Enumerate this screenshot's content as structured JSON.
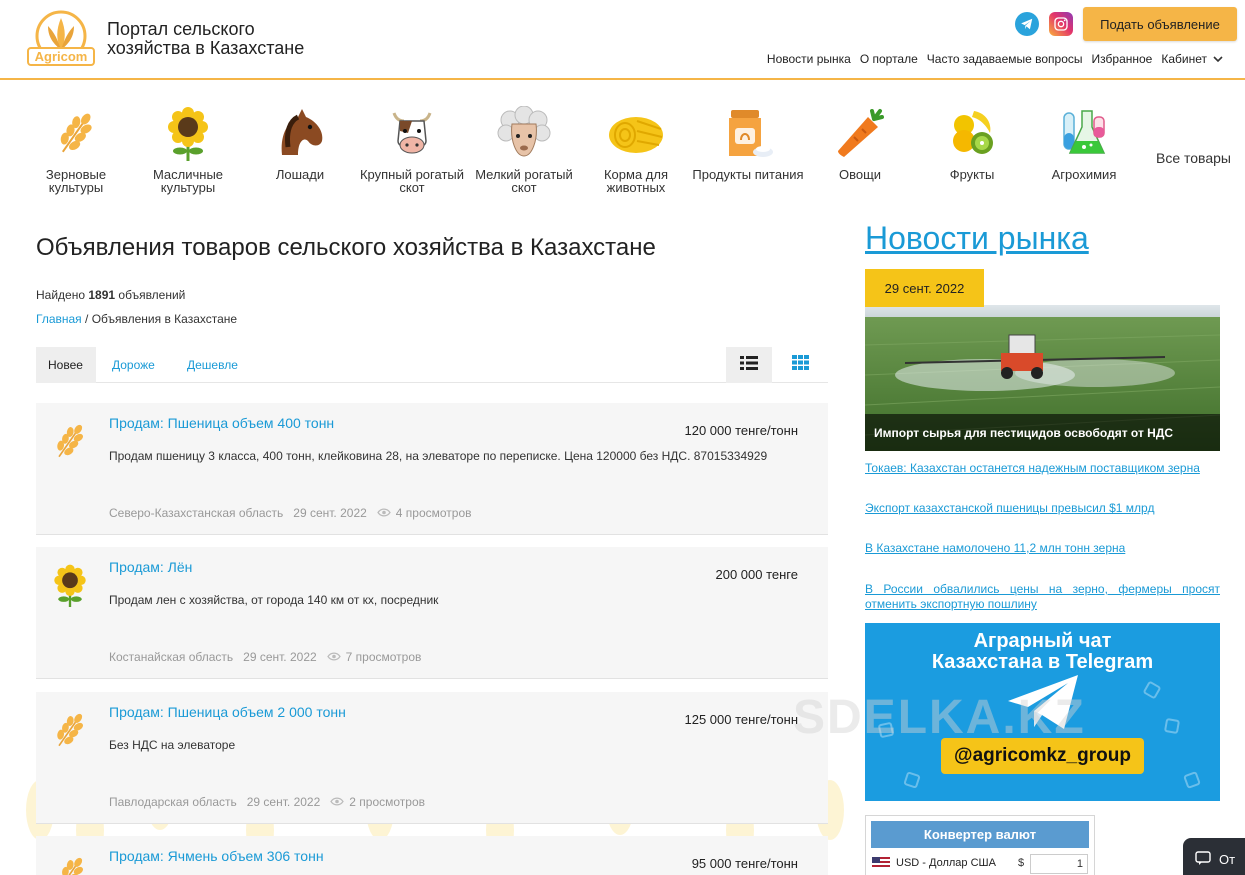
{
  "header": {
    "logo_text": "Agricom",
    "portal_title": "Портал сельского хозяйства в Казахстане",
    "post_ad_label": "Подать объявление",
    "nav": [
      "Новости рынка",
      "О портале",
      "Часто задаваемые вопросы",
      "Избранное",
      "Кабинет"
    ]
  },
  "categories": [
    {
      "label": "Зерновые культуры",
      "icon": "wheat-icon"
    },
    {
      "label": "Масличные культуры",
      "icon": "sunflower-icon"
    },
    {
      "label": "Лошади",
      "icon": "horse-icon"
    },
    {
      "label": "Крупный рогатый скот",
      "icon": "cow-icon"
    },
    {
      "label": "Мелкий рогатый скот",
      "icon": "sheep-icon"
    },
    {
      "label": "Корма для животных",
      "icon": "feed-icon"
    },
    {
      "label": "Продукты питания",
      "icon": "food-products-icon"
    },
    {
      "label": "Овощи",
      "icon": "carrot-icon"
    },
    {
      "label": "Фрукты",
      "icon": "fruits-icon"
    },
    {
      "label": "Агрохимия",
      "icon": "flask-icon"
    }
  ],
  "all_goods_label": "Все товары",
  "main": {
    "title": "Объявления товаров сельского хозяйства в Казахстане",
    "found_prefix": "Найдено",
    "found_count": "1891",
    "found_suffix": "объявлений",
    "breadcrumb": {
      "home": "Главная",
      "separator": "/",
      "current": "Объявления в Казахстане"
    },
    "sort_tabs": [
      "Новее",
      "Дороже",
      "Дешевле"
    ]
  },
  "listings": [
    {
      "title": "Продам: Пшеница объем 400 тонн",
      "price": "120 000 тенге/тонн",
      "description": "Продам пшеницу 3 класса, 400 тонн, клейковина 28, на элеваторе по переписке. Цена 120000 без НДС. 87015334929",
      "region": "Северо-Казахстанская область",
      "date": "29 сент. 2022",
      "views": "4 просмотров",
      "icon": "wheat-icon"
    },
    {
      "title": "Продам: Лён",
      "price": "200 000 тенге",
      "description": "Продам лен с хозяйства, от города 140 км от кх, посредник",
      "region": "Костанайская область",
      "date": "29 сент. 2022",
      "views": "7 просмотров",
      "icon": "sunflower-icon"
    },
    {
      "title": "Продам: Пшеница объем 2 000 тонн",
      "price": "125 000 тенге/тонн",
      "description": "Без НДС на элеваторе",
      "region": "Павлодарская область",
      "date": "29 сент. 2022",
      "views": "2 просмотров",
      "icon": "wheat-icon"
    },
    {
      "title": "Продам: Ячмень объем 306 тонн",
      "price": "95 000 тенге/тонн",
      "description": "",
      "region": "",
      "date": "",
      "views": "",
      "icon": "wheat-icon"
    }
  ],
  "sidebar": {
    "news_heading": "Новости рынка",
    "featured": {
      "date": "29 сент. 2022",
      "caption": "Импорт сырья для пестицидов освободят от НДС"
    },
    "news_links": [
      "Токаев: Казахстан останется надежным поставщиком зерна",
      "Экспорт казахстанской пшеницы превысил $1 млрд",
      "В Казахстане намолочено 11,2 млн тонн зерна",
      "В России обвалились цены на зерно, фермеры просят отменить экспортную пошлину"
    ],
    "banner": {
      "title": "Аграрный чат Казахстана в Telegram",
      "handle": "@agricomkz_group"
    },
    "watermark": "SDELKA.KZ",
    "converter": {
      "title": "Конвертер валют",
      "currency": "USD - Доллар США",
      "symbol": "$",
      "amount": "1"
    }
  },
  "chat_button_label": "От",
  "colors": {
    "accent": "#f5b547",
    "link": "#1a9ad6",
    "news_date_bg": "#f5c418",
    "telegram_banner": "#1b9ce0"
  }
}
